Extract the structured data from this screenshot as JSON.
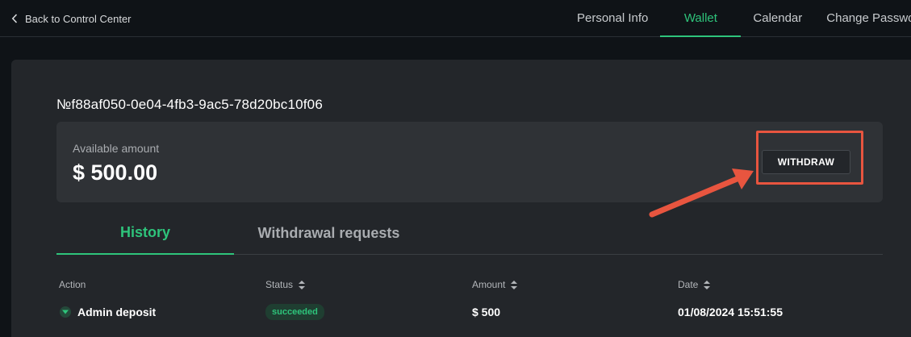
{
  "nav": {
    "back_label": "Back to Control Center",
    "tabs": [
      {
        "label": "Personal Info",
        "active": false
      },
      {
        "label": "Wallet",
        "active": true
      },
      {
        "label": "Calendar",
        "active": false
      },
      {
        "label": "Change Passwo",
        "active": false
      }
    ]
  },
  "wallet": {
    "id": "№f88af050-0e04-4fb3-9ac5-78d20bc10f06",
    "available_label": "Available amount",
    "available_amount": "$ 500.00",
    "withdraw_label": "WITHDRAW"
  },
  "history_tabs": [
    {
      "label": "History",
      "active": true
    },
    {
      "label": "Withdrawal requests",
      "active": false
    }
  ],
  "table": {
    "columns": [
      "Action",
      "Status",
      "Amount",
      "Date"
    ],
    "rows": [
      {
        "action": "Admin deposit",
        "status": "succeeded",
        "amount": "$ 500",
        "date": "01/08/2024 15:51:55"
      }
    ]
  },
  "colors": {
    "accent": "#2ec47b",
    "annotation": "#e8553f",
    "background": "#0f1317",
    "panel": "#23262a"
  },
  "icons": {
    "back": "chevron-left-icon",
    "sort": "sort-icon",
    "expand": "chevron-down-icon"
  }
}
